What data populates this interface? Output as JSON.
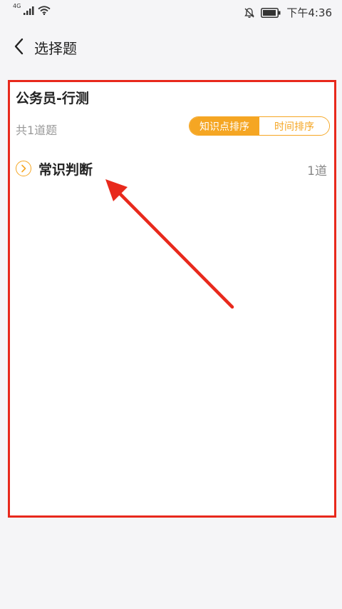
{
  "status_bar": {
    "network": "4G",
    "time": "下午4:36"
  },
  "nav": {
    "title": "选择题"
  },
  "card": {
    "title": "公务员-行测",
    "count_text": "共1道题",
    "sort_options": [
      "知识点排序",
      "时间排序"
    ],
    "selected_sort": "知识点排序"
  },
  "categories": [
    {
      "label": "常识判断",
      "count": "1道"
    }
  ],
  "colors": {
    "accent": "#f5a623",
    "highlight": "#e8291c"
  }
}
